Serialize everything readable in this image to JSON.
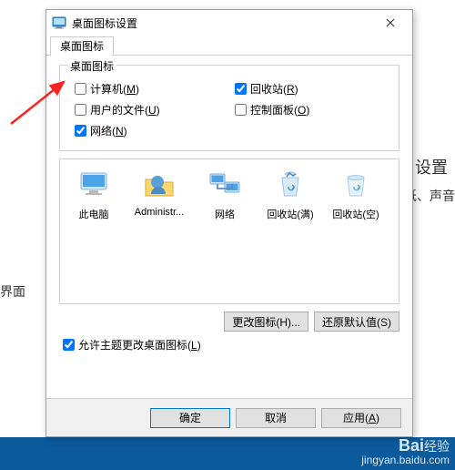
{
  "dialog": {
    "title": "桌面图标设置",
    "tab_label": "桌面图标",
    "group_label": "桌面图标",
    "checks": {
      "computer": {
        "label_pre": "计算机(",
        "hotkey": "M",
        "label_post": ")"
      },
      "recycle": {
        "label_pre": "回收站(",
        "hotkey": "R",
        "label_post": ")"
      },
      "userfiles": {
        "label_pre": "用户的文件(",
        "hotkey": "U",
        "label_post": ")"
      },
      "controlpanel": {
        "label_pre": "控制面板(",
        "hotkey": "O",
        "label_post": ")"
      },
      "network": {
        "label_pre": "网络(",
        "hotkey": "N",
        "label_post": ")"
      }
    },
    "icons": {
      "thispc": "此电脑",
      "admin": "Administr...",
      "network": "网络",
      "recycle_full": "回收站(满)",
      "recycle_empty": "回收站(空)"
    },
    "change_icon_btn": "更改图标(H)...",
    "restore_btn": "还原默认值(S)",
    "allow_themes": {
      "label_pre": "允许主题更改桌面图标(",
      "hotkey": "L",
      "label_post": ")"
    },
    "ok": "确定",
    "cancel": "取消",
    "apply_pre": "应用(",
    "apply_hotkey": "A",
    "apply_post": ")"
  },
  "background": {
    "text1": "设置",
    "text2": "具壁纸、声音",
    "text3": "界面"
  },
  "watermark": {
    "brand": "Bai",
    "brand2": "经验",
    "url": "jingyan.baidu.com"
  }
}
